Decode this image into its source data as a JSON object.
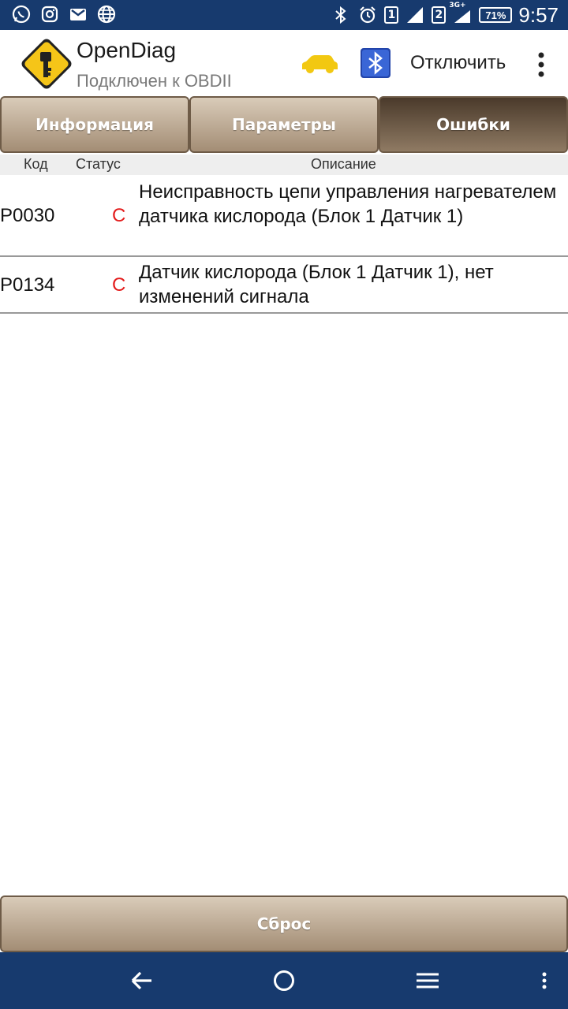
{
  "status_bar": {
    "left_icons": [
      "whatsapp-icon",
      "instagram-icon",
      "gmail-icon",
      "globe-icon"
    ],
    "sim1": "1",
    "sim2": "2",
    "network": "3G+",
    "battery": "71%",
    "time": "9:57"
  },
  "app_bar": {
    "title": "OpenDiag",
    "subtitle": "Подключен к OBDII",
    "disconnect_label": "Отключить"
  },
  "tabs": [
    {
      "label": "Информация",
      "active": false
    },
    {
      "label": "Параметры",
      "active": false
    },
    {
      "label": "Ошибки",
      "active": true
    }
  ],
  "columns": {
    "code": "Код",
    "status": "Статус",
    "description": "Описание"
  },
  "errors": [
    {
      "code": "P0030",
      "status": "C",
      "description": "Неисправность цепи управления нагревателем датчика кислорода (Блок 1 Датчик 1)"
    },
    {
      "code": "P0134",
      "status": "C",
      "description": "Датчик кислорода (Блок 1 Датчик 1), нет изменений сигнала"
    }
  ],
  "reset_label": "Сброс",
  "colors": {
    "status_bar": "#173a6e",
    "tab_gradient_top": "#d9cbb9",
    "tab_gradient_bottom": "#a38d75",
    "tab_active": "#4a3a2b",
    "status_code": "#e31b1b",
    "car_icon": "#f2c811"
  }
}
